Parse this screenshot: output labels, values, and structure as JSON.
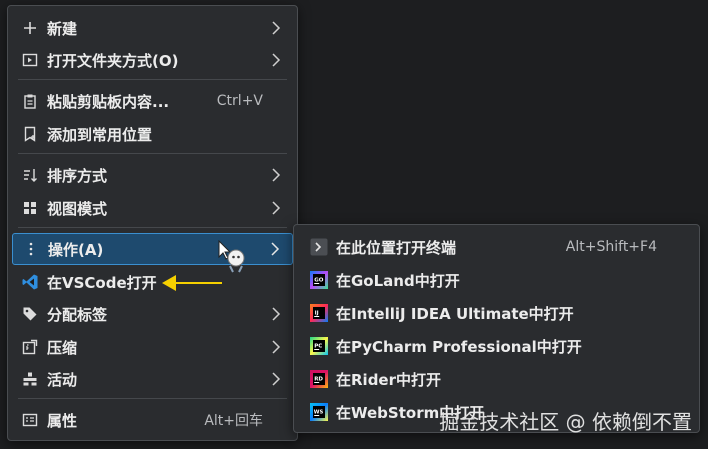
{
  "main_menu": {
    "items": [
      {
        "label": "新建",
        "icon": "plus-icon",
        "submenu": true
      },
      {
        "label": "打开文件夹方式(O)",
        "icon": "open-with-icon",
        "submenu": true
      },
      {
        "label": "粘贴剪贴板内容...",
        "icon": "clipboard-icon",
        "shortcut": "Ctrl+V"
      },
      {
        "label": "添加到常用位置",
        "icon": "bookmark-icon"
      },
      {
        "label": "排序方式",
        "icon": "sort-icon",
        "submenu": true
      },
      {
        "label": "视图模式",
        "icon": "view-grid-icon",
        "submenu": true
      },
      {
        "label": "操作(A)",
        "icon": "more-vertical-icon",
        "submenu": true,
        "highlighted": true
      },
      {
        "label": "在VSCode打开",
        "icon": "vscode-icon"
      },
      {
        "label": "分配标签",
        "icon": "tag-icon",
        "submenu": true
      },
      {
        "label": "压缩",
        "icon": "compress-icon",
        "submenu": true
      },
      {
        "label": "活动",
        "icon": "activities-icon",
        "submenu": true
      },
      {
        "label": "属性",
        "icon": "properties-icon",
        "shortcut": "Alt+回车"
      }
    ]
  },
  "sub_menu": {
    "items": [
      {
        "label": "在此位置打开终端",
        "icon": "terminal-icon",
        "shortcut": "Alt+Shift+F4"
      },
      {
        "label": "在GoLand中打开",
        "icon": "goland-icon",
        "badge": "GO"
      },
      {
        "label": "在IntelliJ IDEA Ultimate中打开",
        "icon": "intellij-icon",
        "badge": "IJ"
      },
      {
        "label": "在PyCharm Professional中打开",
        "icon": "pycharm-icon",
        "badge": "PC"
      },
      {
        "label": "在Rider中打开",
        "icon": "rider-icon",
        "badge": "RD"
      },
      {
        "label": "在WebStorm中打开",
        "icon": "webstorm-icon",
        "badge": "WS"
      }
    ]
  },
  "watermark": "掘金技术社区 @ 依赖倒不置",
  "colors": {
    "menu_bg": "#2a2c2f",
    "highlight_bg": "#1e4a6e",
    "highlight_border": "#3a8fd0",
    "arrow": "#f5d000",
    "vscode": "#2f8fe0"
  }
}
